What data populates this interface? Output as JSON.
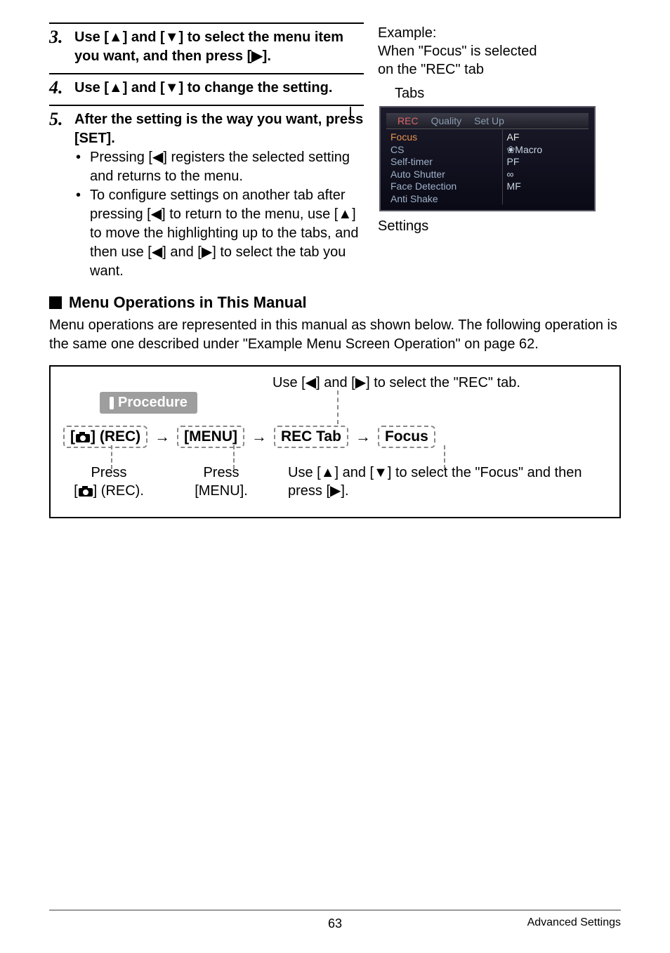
{
  "steps": {
    "s3": {
      "num": "3.",
      "text_a": "Use [",
      "up": "▲",
      "text_b": "] and [",
      "down": "▼",
      "text_c": "] to select the menu item you want, and then press [",
      "right": "▶",
      "text_d": "]."
    },
    "s4": {
      "num": "4.",
      "text_a": "Use [",
      "up": "▲",
      "text_b": "] and [",
      "down": "▼",
      "text_c": "] to change the setting."
    },
    "s5": {
      "num": "5.",
      "text": "After the setting is the way you want, press [SET]."
    },
    "b1_a": "Pressing [",
    "b1_left": "◀",
    "b1_b": "] registers the selected setting and returns to the menu.",
    "b2_a": "To configure settings on another tab after pressing [",
    "b2_left": "◀",
    "b2_b": "] to return to the menu, use [",
    "b2_up": "▲",
    "b2_c": "] to move the highlighting up to the tabs, and then use [",
    "b2_left2": "◀",
    "b2_d": "] and [",
    "b2_right": "▶",
    "b2_e": "] to select the tab you want."
  },
  "example": {
    "line1": "Example:",
    "line2": "When \"Focus\" is selected",
    "line3": "on the \"REC\" tab",
    "tabs_label": "Tabs",
    "settings_label": "Settings",
    "tabs": {
      "rec": "REC",
      "quality": "Quality",
      "setup": "Set Up"
    },
    "left_items": [
      "Focus",
      "CS",
      "Self-timer",
      "Auto Shutter",
      "Face Detection",
      "Anti Shake"
    ],
    "right_items": [
      "AF",
      "Macro",
      "PF",
      "∞",
      "MF"
    ],
    "right_macro_icon": "❀"
  },
  "subhead": "Menu Operations in This Manual",
  "paragraph": "Menu operations are represented in this manual as shown below. The following operation is the same one described under \"Example Menu Screen Operation\" on page 62.",
  "procedure": {
    "badge": "Procedure",
    "top_label_a": "Use [",
    "top_left": "◀",
    "top_label_b": "] and [",
    "top_right": "▶",
    "top_label_c": "] to select the \"REC\" tab.",
    "seq": {
      "rec": "(REC)",
      "menu": "[MENU]",
      "rectab": "REC Tab",
      "focus": "Focus"
    },
    "expl1_a": "Press",
    "expl1_b": "(REC).",
    "expl2_a": "Press",
    "expl2_b": "[MENU].",
    "expl3_a": "Use [",
    "expl3_up": "▲",
    "expl3_b": "] and [",
    "expl3_down": "▼",
    "expl3_c": "] to select the \"Focus\" and then press [",
    "expl3_right": "▶",
    "expl3_d": "]."
  },
  "footer": {
    "page": "63",
    "section": "Advanced Settings"
  }
}
